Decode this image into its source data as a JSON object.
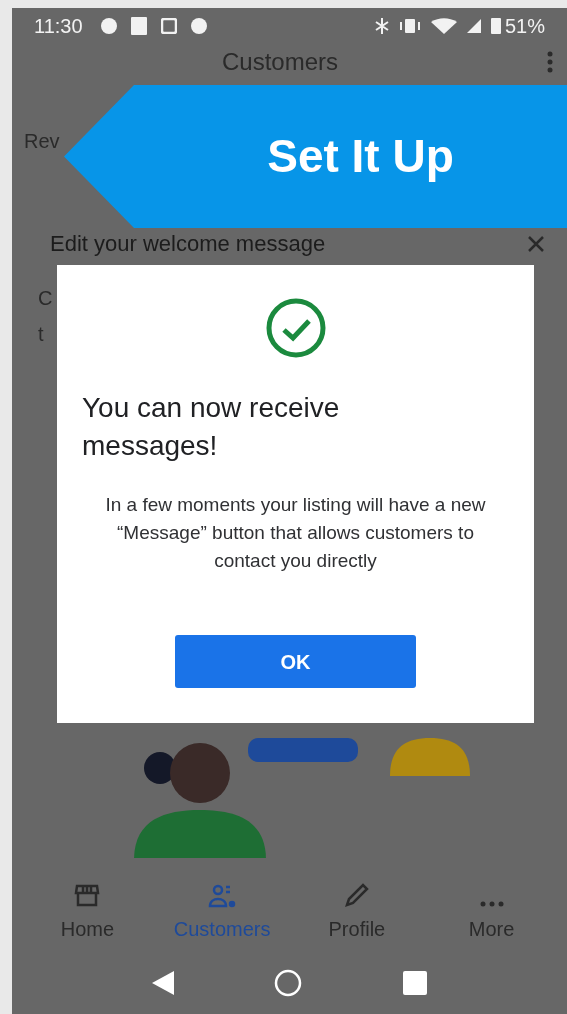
{
  "status_bar": {
    "time": "11:30",
    "battery": "51%"
  },
  "app_bar": {
    "title": "Customers"
  },
  "background": {
    "tab": "Rev",
    "card_title": "Edit your welcome message",
    "card_text_fragments": [
      "C",
      "t"
    ]
  },
  "banner": {
    "text": "Set It Up"
  },
  "dialog": {
    "title": "You can now receive messages!",
    "body": "In a few moments your listing will have a new “Message” button that allows customers to contact you directly",
    "button": "OK"
  },
  "bottom_nav": [
    {
      "label": "Home",
      "kind": "home",
      "selected": false
    },
    {
      "label": "Customers",
      "kind": "customers",
      "selected": true
    },
    {
      "label": "Profile",
      "kind": "profile",
      "selected": false
    },
    {
      "label": "More",
      "kind": "more",
      "selected": false
    }
  ]
}
